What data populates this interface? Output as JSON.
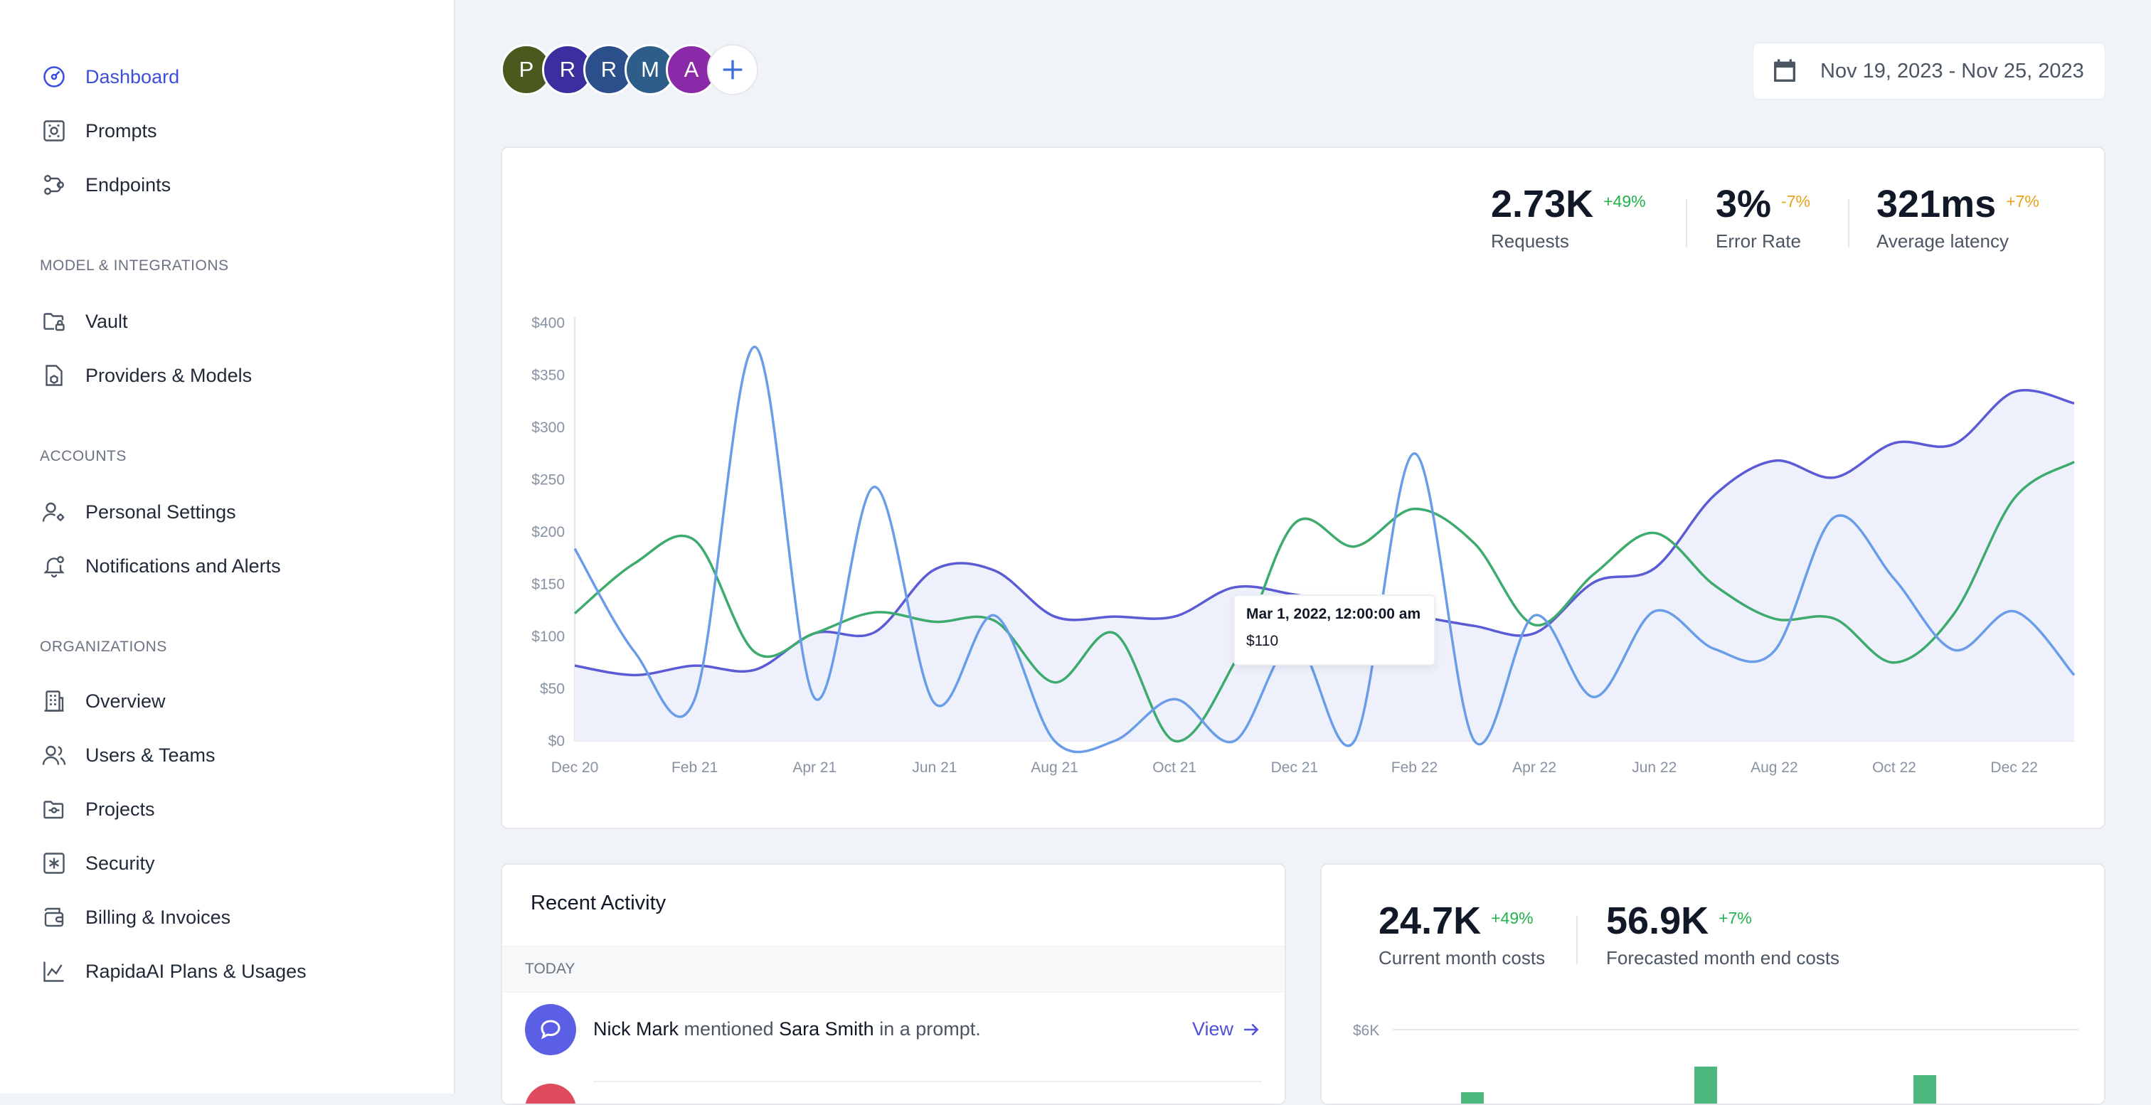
{
  "sidebar": {
    "main_items": [
      {
        "label": "Dashboard",
        "icon": "dashboard-gauge-icon",
        "active": true
      },
      {
        "label": "Prompts",
        "icon": "prompts-icon"
      },
      {
        "label": "Endpoints",
        "icon": "endpoints-icon"
      }
    ],
    "sections": [
      {
        "title": "MODEL & INTEGRATIONS",
        "items": [
          {
            "label": "Vault",
            "icon": "vault-folder-lock-icon"
          },
          {
            "label": "Providers & Models",
            "icon": "providers-cube-icon"
          }
        ]
      },
      {
        "title": "ACCOUNTS",
        "items": [
          {
            "label": "Personal Settings",
            "icon": "user-settings-icon"
          },
          {
            "label": "Notifications and Alerts",
            "icon": "bell-icon"
          }
        ]
      },
      {
        "title": "ORGANIZATIONS",
        "items": [
          {
            "label": "Overview",
            "icon": "building-icon"
          },
          {
            "label": "Users & Teams",
            "icon": "users-icon"
          },
          {
            "label": "Projects",
            "icon": "project-folder-icon"
          },
          {
            "label": "Security",
            "icon": "security-asterisk-icon"
          },
          {
            "label": "Billing & Invoices",
            "icon": "wallet-icon"
          },
          {
            "label": "RapidaAI Plans & Usages",
            "icon": "chart-line-icon"
          }
        ]
      }
    ]
  },
  "header": {
    "avatars": [
      {
        "letter": "P",
        "color": "#4a5a1e"
      },
      {
        "letter": "R",
        "color": "#3b2fa0"
      },
      {
        "letter": "R",
        "color": "#2a4f8a"
      },
      {
        "letter": "M",
        "color": "#2d5e8a"
      },
      {
        "letter": "A",
        "color": "#8a2aa8"
      }
    ],
    "date_range": "Nov 19, 2023 - Nov 25, 2023"
  },
  "stats": {
    "requests": {
      "value": "2.73K",
      "change": "+49%",
      "label": "Requests"
    },
    "error_rate": {
      "value": "3%",
      "change": "-7%",
      "label": "Error Rate"
    },
    "latency": {
      "value": "321ms",
      "change": "+7%",
      "label": "Average latency"
    }
  },
  "colors": {
    "purple": "#5b5bd6",
    "green": "#3daa6e",
    "blue": "#6a9de8",
    "area": "#eef1fb",
    "accent": "#3b4fd8"
  },
  "chart_data": {
    "type": "line",
    "ylim": [
      0,
      400
    ],
    "yticks": [
      "$0",
      "$50",
      "$100",
      "$150",
      "$200",
      "$250",
      "$300",
      "$350",
      "$400"
    ],
    "xticks": [
      "Dec 20",
      "Feb 21",
      "Apr 21",
      "Jun 21",
      "Aug 21",
      "Oct 21",
      "Dec 21",
      "Feb 22",
      "Apr 22",
      "Jun 22",
      "Aug 22",
      "Oct 22",
      "Dec 22"
    ],
    "x": [
      "Dec 20",
      "Jan 21",
      "Feb 21",
      "Mar 21",
      "Apr 21",
      "May 21",
      "Jun 21",
      "Jul 21",
      "Aug 21",
      "Sep 21",
      "Oct 21",
      "Nov 21",
      "Dec 21",
      "Jan 22",
      "Feb 22",
      "Mar 22",
      "Apr 22",
      "May 22",
      "Jun 22",
      "Jul 22",
      "Aug 22",
      "Sep 22",
      "Oct 22",
      "Nov 22",
      "Dec 22",
      "Jan 23"
    ],
    "series": [
      {
        "color": "purple",
        "area": true,
        "values": [
          72,
          63,
          72,
          68,
          103,
          104,
          164,
          163,
          119,
          119,
          119,
          147,
          140,
          130,
          120,
          110,
          103,
          152,
          165,
          235,
          268,
          252,
          285,
          284,
          334,
          323
        ]
      },
      {
        "color": "green",
        "values": [
          122,
          170,
          192,
          85,
          103,
          123,
          114,
          115,
          56,
          103,
          0,
          75,
          208,
          186,
          222,
          189,
          111,
          160,
          199,
          149,
          117,
          117,
          75,
          122,
          232,
          267
        ]
      },
      {
        "color": "blue",
        "values": [
          184,
          85,
          40,
          377,
          41,
          243,
          36,
          120,
          0,
          0,
          40,
          0,
          95,
          0,
          275,
          0,
          120,
          42,
          124,
          88,
          86,
          214,
          155,
          87,
          124,
          63
        ]
      }
    ],
    "tooltip": {
      "title": "Mar 1, 2022, 12:00:00 am",
      "value": "$110"
    }
  },
  "activity": {
    "title": "Recent Activity",
    "group": "TODAY",
    "item": {
      "actor": "Nick Mark",
      "verb": "mentioned",
      "target": "Sara Smith",
      "suffix": "in a prompt.",
      "link": "View"
    }
  },
  "costs": {
    "current": {
      "value": "24.7K",
      "change": "+49%",
      "label": "Current month costs"
    },
    "forecast": {
      "value": "56.9K",
      "change": "+7%",
      "label": "Forecasted month end costs"
    },
    "y_tick": "$6K"
  }
}
